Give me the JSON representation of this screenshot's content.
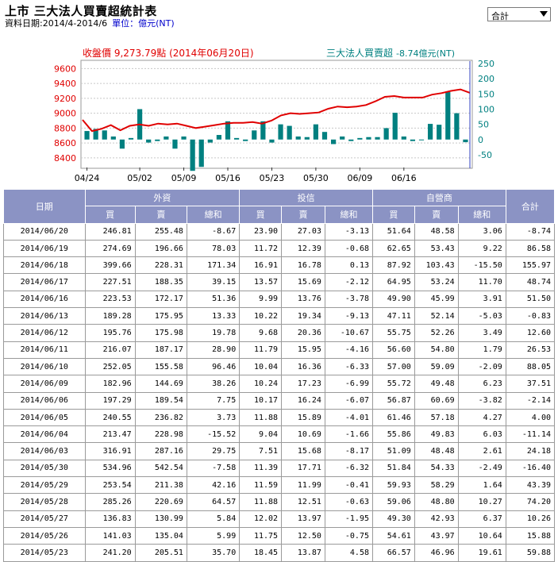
{
  "header": {
    "title": "上市 三大法人買賣超統計表",
    "date_range": "資料日期:2014/4-2014/6",
    "unit": "單位：億元(NT)"
  },
  "selector": {
    "value": "合計"
  },
  "chart_header": {
    "left": "收盤價 9,273.79點 (2014年06月20日)",
    "right_main": "三大法人買賣超",
    "right_value": "-8.74億元(NT)"
  },
  "colors": {
    "price_line": "#e00000",
    "bar": "#008080",
    "header_bg": "#8b93c4"
  },
  "chart_data": {
    "type": "line+bar",
    "left_axis": {
      "ticks": [
        9600,
        9400,
        9200,
        9000,
        8800,
        8600,
        8400
      ],
      "range": [
        8270,
        9700
      ]
    },
    "right_axis": {
      "ticks": [
        250,
        200,
        150,
        100,
        50,
        0,
        -50
      ],
      "range": [
        -92,
        258
      ]
    },
    "x_ticks": [
      "04/24",
      "05/02",
      "05/09",
      "05/16",
      "05/23",
      "05/30",
      "06/09",
      "06/16"
    ],
    "x_tick_index": [
      0,
      6,
      11,
      16,
      21,
      26,
      31,
      36
    ],
    "price": [
      8910,
      8760,
      8790,
      8840,
      8770,
      8830,
      8850,
      8830,
      8860,
      8850,
      8860,
      8830,
      8800,
      8820,
      8840,
      8860,
      8870,
      8870,
      8880,
      8860,
      8900,
      8970,
      9000,
      8990,
      9000,
      9010,
      9060,
      9090,
      9080,
      9090,
      9110,
      9160,
      9220,
      9230,
      9210,
      9210,
      9210,
      9250,
      9270,
      9300,
      9320,
      9273.79
    ],
    "net": [
      28,
      35,
      30,
      10,
      -30,
      5,
      100,
      -10,
      -5,
      10,
      -30,
      10,
      -103,
      -90,
      -10,
      15,
      60,
      5,
      -5,
      30,
      60,
      -10,
      50,
      45,
      10,
      8,
      50,
      25,
      -15,
      10,
      -5,
      5,
      8,
      8,
      37.5,
      88,
      10,
      -5,
      0,
      51.5,
      48.7,
      156,
      86.6,
      -8.74
    ],
    "price_label": "收盤價",
    "net_label": "三大法人買賣超"
  },
  "table": {
    "group_headers": [
      "日期",
      "外資",
      "投信",
      "自營商",
      "合計"
    ],
    "sub_headers": [
      "買",
      "賣",
      "總和",
      "買",
      "賣",
      "總和",
      "買",
      "賣",
      "總和"
    ],
    "rows": [
      [
        "2014/06/20",
        "246.81",
        "255.48",
        "-8.67",
        "23.90",
        "27.03",
        "-3.13",
        "51.64",
        "48.58",
        "3.06",
        "-8.74"
      ],
      [
        "2014/06/19",
        "274.69",
        "196.66",
        "78.03",
        "11.72",
        "12.39",
        "-0.68",
        "62.65",
        "53.43",
        "9.22",
        "86.58"
      ],
      [
        "2014/06/18",
        "399.66",
        "228.31",
        "171.34",
        "16.91",
        "16.78",
        "0.13",
        "87.92",
        "103.43",
        "-15.50",
        "155.97"
      ],
      [
        "2014/06/17",
        "227.51",
        "188.35",
        "39.15",
        "13.57",
        "15.69",
        "-2.12",
        "64.95",
        "53.24",
        "11.70",
        "48.74"
      ],
      [
        "2014/06/16",
        "223.53",
        "172.17",
        "51.36",
        "9.99",
        "13.76",
        "-3.78",
        "49.90",
        "45.99",
        "3.91",
        "51.50"
      ],
      [
        "2014/06/13",
        "189.28",
        "175.95",
        "13.33",
        "10.22",
        "19.34",
        "-9.13",
        "47.11",
        "52.14",
        "-5.03",
        "-0.83"
      ],
      [
        "2014/06/12",
        "195.76",
        "175.98",
        "19.78",
        "9.68",
        "20.36",
        "-10.67",
        "55.75",
        "52.26",
        "3.49",
        "12.60"
      ],
      [
        "2014/06/11",
        "216.07",
        "187.17",
        "28.90",
        "11.79",
        "15.95",
        "-4.16",
        "56.60",
        "54.80",
        "1.79",
        "26.53"
      ],
      [
        "2014/06/10",
        "252.05",
        "155.58",
        "96.46",
        "10.04",
        "16.36",
        "-6.33",
        "57.00",
        "59.09",
        "-2.09",
        "88.05"
      ],
      [
        "2014/06/09",
        "182.96",
        "144.69",
        "38.26",
        "10.24",
        "17.23",
        "-6.99",
        "55.72",
        "49.48",
        "6.23",
        "37.51"
      ],
      [
        "2014/06/06",
        "197.29",
        "189.54",
        "7.75",
        "10.17",
        "16.24",
        "-6.07",
        "56.87",
        "60.69",
        "-3.82",
        "-2.14"
      ],
      [
        "2014/06/05",
        "240.55",
        "236.82",
        "3.73",
        "11.88",
        "15.89",
        "-4.01",
        "61.46",
        "57.18",
        "4.27",
        "4.00"
      ],
      [
        "2014/06/04",
        "213.47",
        "228.98",
        "-15.52",
        "9.04",
        "10.69",
        "-1.66",
        "55.86",
        "49.83",
        "6.03",
        "-11.14"
      ],
      [
        "2014/06/03",
        "316.91",
        "287.16",
        "29.75",
        "7.51",
        "15.68",
        "-8.17",
        "51.09",
        "48.48",
        "2.61",
        "24.18"
      ],
      [
        "2014/05/30",
        "534.96",
        "542.54",
        "-7.58",
        "11.39",
        "17.71",
        "-6.32",
        "51.84",
        "54.33",
        "-2.49",
        "-16.40"
      ],
      [
        "2014/05/29",
        "253.54",
        "211.38",
        "42.16",
        "11.59",
        "11.99",
        "-0.41",
        "59.93",
        "58.29",
        "1.64",
        "43.39"
      ],
      [
        "2014/05/28",
        "285.26",
        "220.69",
        "64.57",
        "11.88",
        "12.51",
        "-0.63",
        "59.06",
        "48.80",
        "10.27",
        "74.20"
      ],
      [
        "2014/05/27",
        "136.83",
        "130.99",
        "5.84",
        "12.02",
        "13.97",
        "-1.95",
        "49.30",
        "42.93",
        "6.37",
        "10.26"
      ],
      [
        "2014/05/26",
        "141.03",
        "135.04",
        "5.99",
        "11.75",
        "12.50",
        "-0.75",
        "54.61",
        "43.97",
        "10.64",
        "15.88"
      ],
      [
        "2014/05/23",
        "241.20",
        "205.51",
        "35.70",
        "18.45",
        "13.87",
        "4.58",
        "66.57",
        "46.96",
        "19.61",
        "59.88"
      ]
    ]
  }
}
